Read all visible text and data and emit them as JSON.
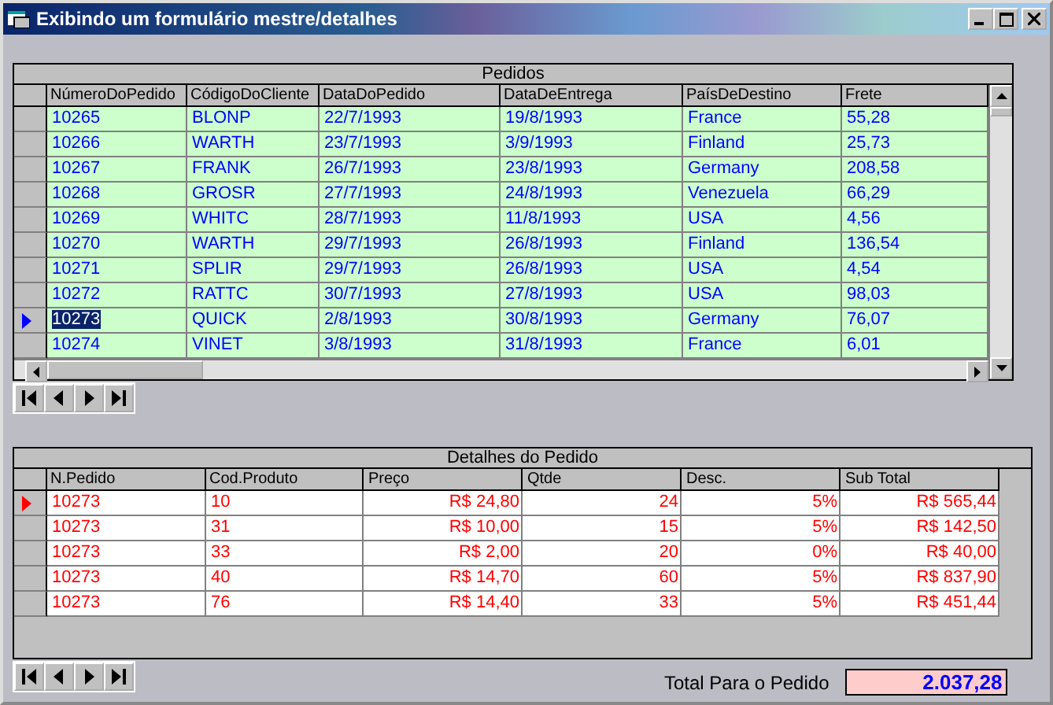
{
  "window": {
    "title": "Exibindo um formulário mestre/detalhes"
  },
  "orders": {
    "caption": "Pedidos",
    "columns": [
      "NúmeroDoPedido",
      "CódigoDoCliente",
      "DataDoPedido",
      "DataDeEntrega",
      "PaísDeDestino",
      "Frete"
    ],
    "rows": [
      {
        "cells": [
          "10265",
          "BLONP",
          "22/7/1993",
          "19/8/1993",
          "France",
          "55,28"
        ],
        "selected": false
      },
      {
        "cells": [
          "10266",
          "WARTH",
          "23/7/1993",
          "3/9/1993",
          "Finland",
          "25,73"
        ],
        "selected": false
      },
      {
        "cells": [
          "10267",
          "FRANK",
          "26/7/1993",
          "23/8/1993",
          "Germany",
          "208,58"
        ],
        "selected": false
      },
      {
        "cells": [
          "10268",
          "GROSR",
          "27/7/1993",
          "24/8/1993",
          "Venezuela",
          "66,29"
        ],
        "selected": false
      },
      {
        "cells": [
          "10269",
          "WHITC",
          "28/7/1993",
          "11/8/1993",
          "USA",
          "4,56"
        ],
        "selected": false
      },
      {
        "cells": [
          "10270",
          "WARTH",
          "29/7/1993",
          "26/8/1993",
          "Finland",
          "136,54"
        ],
        "selected": false
      },
      {
        "cells": [
          "10271",
          "SPLIR",
          "29/7/1993",
          "26/8/1993",
          "USA",
          "4,54"
        ],
        "selected": false
      },
      {
        "cells": [
          "10272",
          "RATTC",
          "30/7/1993",
          "27/8/1993",
          "USA",
          "98,03"
        ],
        "selected": false
      },
      {
        "cells": [
          "10273",
          "QUICK",
          "2/8/1993",
          "30/8/1993",
          "Germany",
          "76,07"
        ],
        "selected": true
      },
      {
        "cells": [
          "10274",
          "VINET",
          "3/8/1993",
          "31/8/1993",
          "France",
          "6,01"
        ],
        "selected": false
      }
    ]
  },
  "details": {
    "caption": "Detalhes do Pedido",
    "columns": [
      "N.Pedido",
      "Cod.Produto",
      "Preço",
      "Qtde",
      "Desc.",
      "Sub Total"
    ],
    "rows": [
      {
        "cells": [
          "10273",
          "10",
          "R$ 24,80",
          "24",
          "5%",
          "R$ 565,44"
        ],
        "selected": true
      },
      {
        "cells": [
          "10273",
          "31",
          "R$ 10,00",
          "15",
          "5%",
          "R$ 142,50"
        ],
        "selected": false
      },
      {
        "cells": [
          "10273",
          "33",
          "R$ 2,00",
          "20",
          "0%",
          "R$ 40,00"
        ],
        "selected": false
      },
      {
        "cells": [
          "10273",
          "40",
          "R$ 14,70",
          "60",
          "5%",
          "R$ 837,90"
        ],
        "selected": false
      },
      {
        "cells": [
          "10273",
          "76",
          "R$ 14,40",
          "33",
          "5%",
          "R$ 451,44"
        ],
        "selected": false
      }
    ]
  },
  "total": {
    "label": "Total Para o Pedido",
    "value": "2.037,28"
  }
}
